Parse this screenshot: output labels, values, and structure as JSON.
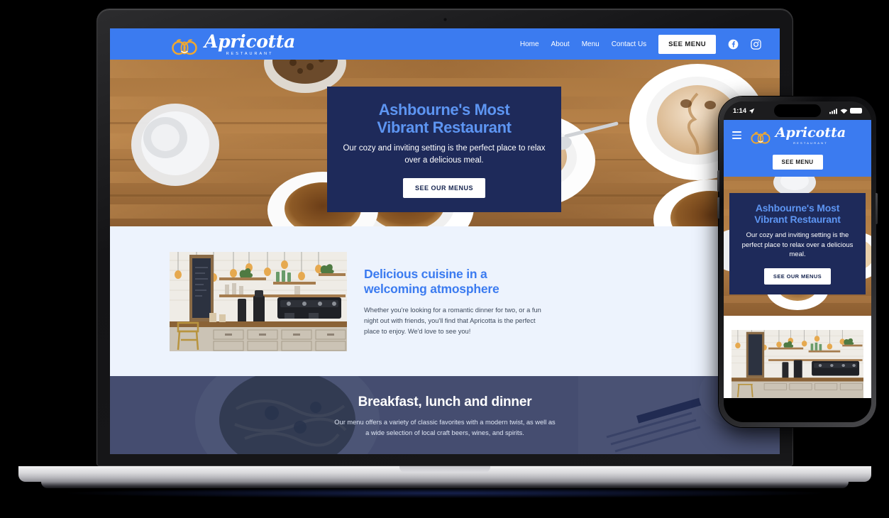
{
  "brand": {
    "name": "Apricotta",
    "tagline": "RESTAURANT",
    "colors": {
      "header_blue": "#3B7BF0",
      "navy_card": "#1E2A5A",
      "light_section": "#EDF3FD",
      "accent_text_blue": "#5D95F2",
      "logo_fruit": "#F0A830"
    }
  },
  "desktop": {
    "nav": {
      "links": [
        {
          "label": "Home"
        },
        {
          "label": "About"
        },
        {
          "label": "Menu"
        },
        {
          "label": "Contact Us"
        }
      ],
      "cta_label": "SEE MENU",
      "social": [
        {
          "name": "facebook-icon"
        },
        {
          "name": "instagram-icon"
        }
      ]
    },
    "hero": {
      "title_line1": "Ashbourne's Most",
      "title_line2": "Vibrant Restaurant",
      "subtitle": "Our cozy and inviting setting is the perfect place to relax over a delicious meal.",
      "button_label": "SEE OUR MENUS",
      "background_description": "coffee-cups-on-wooden-table-photo"
    },
    "about": {
      "title_line1": "Delicious cuisine in a",
      "title_line2": "welcoming atmosphere",
      "text": "Whether you're looking for a romantic dinner for two, or a fun night out with friends, you'll find that Apricotta is the perfect place to enjoy. We'd love to see you!",
      "image_description": "cafe-interior-espresso-bar-photo"
    },
    "band": {
      "title": "Breakfast, lunch and dinner",
      "text_line1": "Our menu offers a variety of classic favorites with a modern twist, as well as",
      "text_line2": "a wide selection of local craft beers, wines, and spirits.",
      "background_description": "pasta-dish-overhead-photo"
    }
  },
  "phone": {
    "status": {
      "time": "1:14",
      "location_icon": "location-arrow-icon",
      "signal_icon": "cellular-signal-icon",
      "wifi_icon": "wifi-icon",
      "battery_icon": "battery-full-icon"
    },
    "nav": {
      "menu_icon": "hamburger-menu-icon",
      "cta_label": "SEE MENU"
    },
    "hero": {
      "title_line1": "Ashbourne's Most",
      "title_line2": "Vibrant Restaurant",
      "subtitle": "Our cozy and inviting setting is the perfect place to relax over a delicious meal.",
      "button_label": "SEE OUR MENUS"
    },
    "about": {
      "image_description": "cafe-interior-espresso-bar-photo"
    }
  }
}
